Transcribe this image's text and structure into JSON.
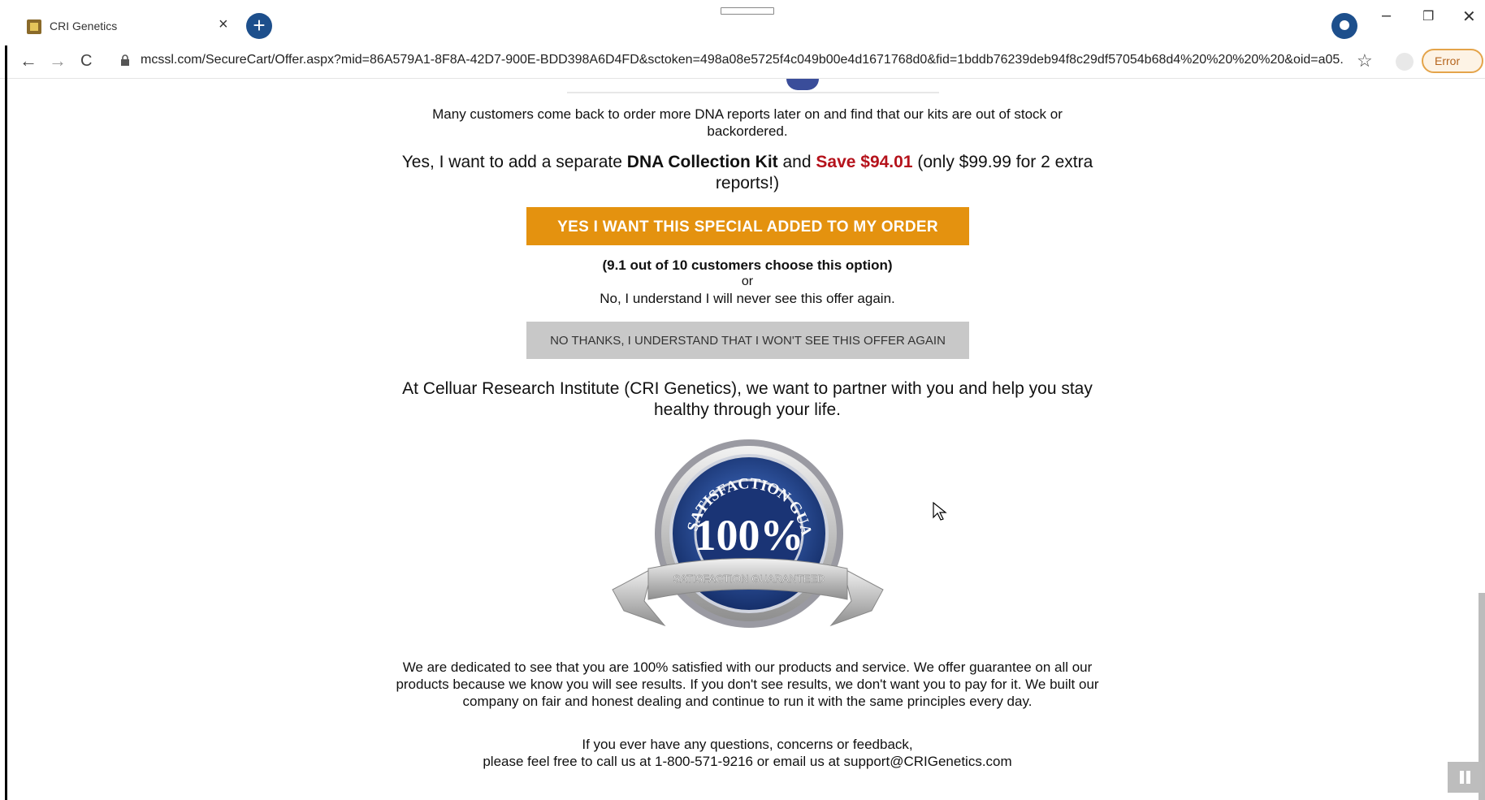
{
  "browser": {
    "tab_title": "CRI Genetics",
    "tab_close": "×",
    "new_tab": "+",
    "url": "mcssl.com/SecureCart/Offer.aspx?mid=86A579A1-8F8A-42D7-900E-BDD398A6D4FD&sctoken=498a08e5725f4c049b00e4d1671768d0&fid=1bddb76239deb94f8c29df57054b68d4%20%20%20%20&oid=a05...",
    "error_label": "Error",
    "minimize": "–",
    "restore": "❐",
    "close": "✕",
    "back": "←",
    "forward": "→",
    "reload": "C",
    "star": "☆"
  },
  "offer": {
    "intro": "Many customers come back to order more DNA reports later on and find that our kits are out of stock or backordered.",
    "pitch_prefix": "Yes, I want to add a separate ",
    "pitch_product": "DNA Collection Kit",
    "pitch_and": " and ",
    "pitch_save": "Save $94.01",
    "pitch_suffix": " (only $99.99 for 2 extra reports!)",
    "yes_button": "YES I WANT THIS SPECIAL ADDED TO MY ORDER",
    "social_proof": "(9.1 out of 10 customers choose this option)",
    "or": "or",
    "decline_text": "No, I understand I will never see this offer again.",
    "no_button": "NO THANKS, I UNDERSTAND THAT I WON'T SEE THIS OFFER AGAIN",
    "partner_text": "At Celluar Research Institute (CRI Genetics), we want to partner with you and help you stay healthy through your life."
  },
  "seal": {
    "arc_text": "SATISFACTION GUARANTEED",
    "percent": "100%",
    "ribbon_text": "SATISFACTION GUARANTEED"
  },
  "guarantee": {
    "paragraph": "We are dedicated to see that you are 100% satisfied with our products and service. We offer guarantee on all our products because we know you will see results. If you don't see results, we don't want you to pay for it. We built our company on fair and honest dealing and continue to run it with the same principles every day.",
    "contact_line1": "If you ever have any questions, concerns or feedback,",
    "contact_line2": "please feel free to call us at 1-800-571-9216 or email us at support@CRIGenetics.com"
  },
  "colors": {
    "accent_orange": "#e4920f",
    "save_red": "#b5121b",
    "seal_blue": "#1c3f8c"
  }
}
